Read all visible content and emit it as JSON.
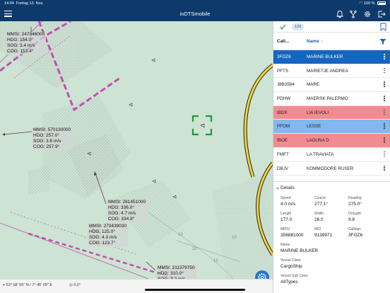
{
  "status_bar": {
    "time": "14:04",
    "date": "Freitag 13. Nov.",
    "battery": "100 %"
  },
  "app": {
    "title": "inDTSmobile"
  },
  "map": {
    "vessel_labels": [
      {
        "lines": "MMSI: 247346000\nHDG: 154.0°\nSOG: 3.4 m/s\nCOG: 153.4°"
      },
      {
        "lines": "MMSI: 570130000\nHDG: 257.0°\nSOG: 3.6 m/s\nCOG: 257.9°"
      },
      {
        "lines": "MMSI: 261451000\nHDG: 336.0°\nSOG: 4.7 m/s\nCOG: 334.8°"
      },
      {
        "lines": "MMSI: 273439030\nHDG: 125.0°\nSOG: 4.3 m/s\nCOG: 123.7°"
      },
      {
        "lines": "MMSI: 211379750\nHDG: 310.0°\nSOG: 3.2 m/s"
      }
    ],
    "depth_labels": [
      "10",
      "10",
      "10",
      "10"
    ]
  },
  "bottom_bar": {
    "coords": "53° 58' 55\" N / 7° 46' 09\" E",
    "heading": "0.0°"
  },
  "panel": {
    "count": "129",
    "columns": {
      "call": "Call...",
      "name": "Name ↑"
    },
    "rows": [
      {
        "call": "3FOZ6",
        "name": "MARINE BULKER",
        "state": "selected"
      },
      {
        "call": "PFTS",
        "name": "MARIETJE ANDREA",
        "state": ""
      },
      {
        "call": "J8B3584",
        "name": "MARE",
        "state": ""
      },
      {
        "call": "PDHW",
        "name": "MAERSK PALERMO",
        "state": ""
      },
      {
        "call": "IBDX",
        "name": "LIA IEVOLI",
        "state": "red"
      },
      {
        "call": "PFOM",
        "name": "LESSE",
        "state": "blue"
      },
      {
        "call": "IBOE",
        "name": "LAGUNA D",
        "state": "red"
      },
      {
        "call": "FMFT",
        "name": "LA TRAVIATA",
        "state": ""
      },
      {
        "call": "DBJV",
        "name": "KOMMODORE RUSER",
        "state": ""
      }
    ],
    "details": {
      "title": "Details",
      "speed_label": "Speed",
      "speed": "4.0 m/s",
      "course_label": "Course",
      "course": "277.1°",
      "heading_label": "Heading",
      "heading": "275.0°",
      "length_label": "Length",
      "length": "177.0",
      "width_label": "Width",
      "width": "26.0",
      "draught_label": "Draught",
      "draught": "9.8",
      "mmsi_label": "MMSI",
      "mmsi": "356881000",
      "imo_label": "IMO",
      "imo": "9139971",
      "callsign_label": "Callsign",
      "callsign": "3FOZ6",
      "name_label": "Name",
      "name": "MARINE BULKER",
      "vessel_class_label": "Vessel Class",
      "vessel_class": "CargoShip",
      "vessel_subclass_label": "Vessel Sub Class",
      "vessel_subclass": "AllTypes"
    }
  },
  "colors": {
    "header": "#0d3a6b",
    "selected_row": "#1665c0",
    "alert_row": "#f28b8f",
    "info_row": "#82b8ef",
    "map_water": "#cde3d3",
    "traffic_zone": "#c04fb0",
    "target_bracket": "#1f9a3a"
  }
}
